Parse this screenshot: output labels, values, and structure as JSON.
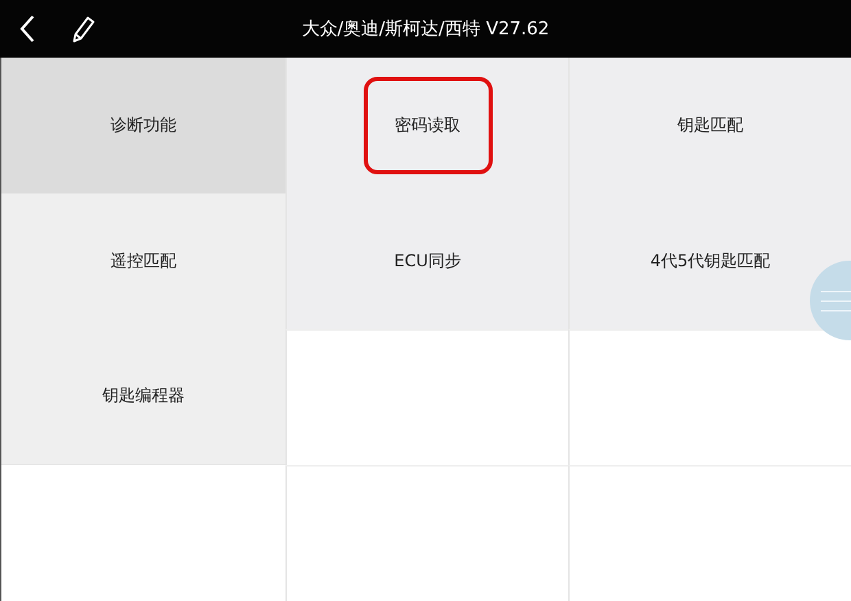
{
  "title_bar": {
    "title": "大众/奥迪/斯柯达/西特 V27.62"
  },
  "sidebar": {
    "items": [
      {
        "label": "诊断功能",
        "selected": true
      },
      {
        "label": "遥控匹配",
        "selected": false
      },
      {
        "label": "钥匙编程器",
        "selected": false
      }
    ]
  },
  "grid": {
    "items": [
      {
        "label": "密码读取",
        "highlighted": true
      },
      {
        "label": "钥匙匹配",
        "highlighted": false
      },
      {
        "label": "ECU同步",
        "highlighted": false
      },
      {
        "label": "4代5代钥匙匹配",
        "highlighted": false
      }
    ]
  }
}
